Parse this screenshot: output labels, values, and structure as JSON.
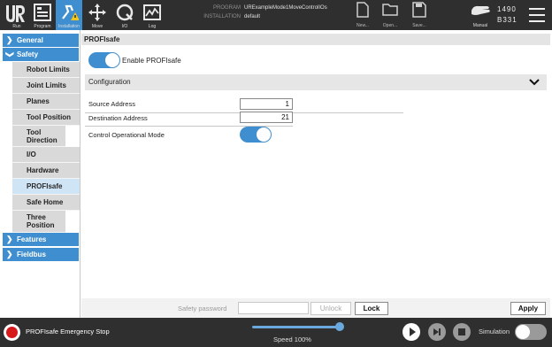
{
  "topbar": {
    "nav": [
      {
        "label": "Run",
        "icon": "run-icon"
      },
      {
        "label": "Program",
        "icon": "program-icon"
      },
      {
        "label": "Installation",
        "icon": "installation-icon",
        "active": true
      },
      {
        "label": "Move",
        "icon": "move-icon"
      },
      {
        "label": "I/O",
        "icon": "io-icon"
      },
      {
        "label": "Log",
        "icon": "log-icon"
      }
    ],
    "program_key": "PROGRAM",
    "program_value": "URExampleMode1MoveControlIOs",
    "installation_key": "INSTALLATION",
    "installation_value": "default",
    "file_buttons": [
      {
        "label": "New...",
        "icon": "new-file-icon"
      },
      {
        "label": "Open...",
        "icon": "open-folder-icon"
      },
      {
        "label": "Save...",
        "icon": "save-icon"
      }
    ],
    "mode_label": "Manual",
    "counter_top": "1490",
    "counter_bottom": "B331"
  },
  "sidebar": {
    "general": "General",
    "safety": "Safety",
    "items": [
      {
        "label": "Robot Limits"
      },
      {
        "label": "Joint Limits"
      },
      {
        "label": "Planes"
      },
      {
        "label": "Tool Position"
      },
      {
        "label": "Tool Direction"
      },
      {
        "label": "I/O"
      },
      {
        "label": "Hardware"
      },
      {
        "label": "PROFIsafe",
        "selected": true
      },
      {
        "label": "Safe Home"
      },
      {
        "label": "Three Position"
      }
    ],
    "features": "Features",
    "fieldbus": "Fieldbus"
  },
  "main": {
    "title": "PROFIsafe",
    "enable_label": "Enable PROFIsafe",
    "enable_on": true,
    "configuration_label": "Configuration",
    "source_address_label": "Source Address",
    "source_address_value": "1",
    "destination_address_label": "Destination Address",
    "destination_address_value": "21",
    "control_mode_label": "Control Operational Mode",
    "control_mode_on": true,
    "safety_password_label": "Safety password",
    "unlock_label": "Unlock",
    "lock_label": "Lock",
    "apply_label": "Apply"
  },
  "statusbar": {
    "status_text": "PROFIsafe Emergency Stop",
    "speed_label": "Speed 100%",
    "speed_percent": 100,
    "simulation_label": "Simulation",
    "simulation_on": false
  },
  "colors": {
    "accent": "#3f8fd0",
    "topbar": "#2f2f2f",
    "estop_red": "#d7191c"
  }
}
